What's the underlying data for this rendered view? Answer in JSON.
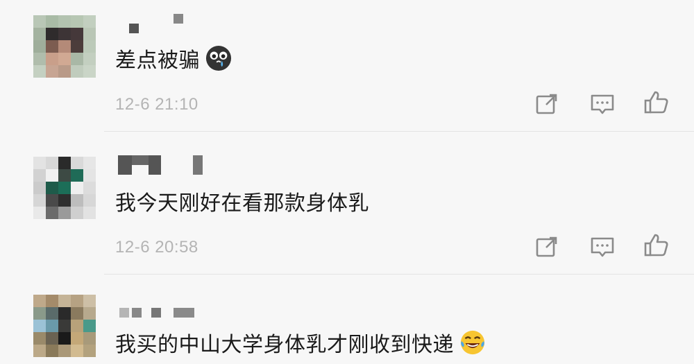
{
  "comments": [
    {
      "text": "差点被骗",
      "time": "12-6 21:10",
      "emoji": "crying-face-emoji"
    },
    {
      "text": "我今天刚好在看那款身体乳",
      "time": "12-6 20:58",
      "emoji": ""
    },
    {
      "text": "我买的中山大学身体乳才刚收到快递",
      "time": "",
      "emoji": "laughing-tears-emoji"
    }
  ],
  "icons": {
    "share": "share-icon",
    "reply": "comment-icon",
    "like": "thumbs-up-icon"
  },
  "colors": {
    "background": "#f7f7f7",
    "text": "#1a1a1a",
    "meta": "#b4b4b4",
    "icon": "#8a8a8a",
    "divider": "#e4e4e4"
  }
}
